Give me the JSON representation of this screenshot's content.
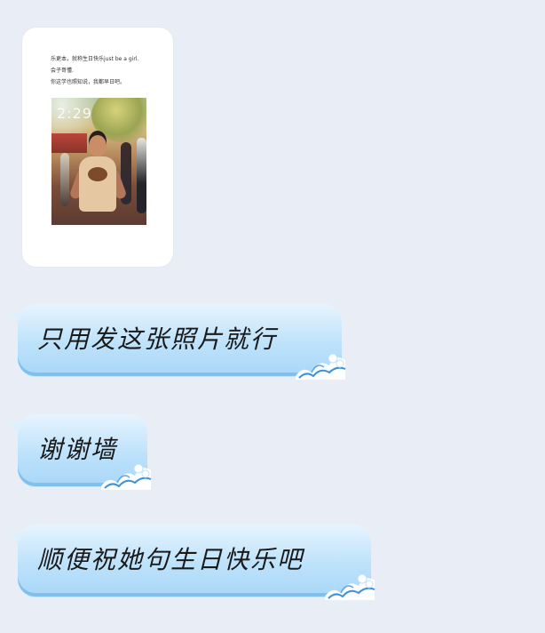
{
  "image_card": {
    "caption_lines": [
      "乐更本，就称生日快乐just be a girl.",
      "会子哥懂.",
      "你这学也照知说，我都早日吧。"
    ],
    "photo_overlay_text": "2:29"
  },
  "messages": [
    {
      "text": "只用发这张照片就行"
    },
    {
      "text": "谢谢墙"
    },
    {
      "text": "顺便祝她句生日快乐吧"
    }
  ],
  "colors": {
    "background": "#e9edf5",
    "bubble_top": "#e7f4fe",
    "bubble_bottom": "#a9d7f8",
    "bubble_edge": "#7fc0ef"
  },
  "icons": {
    "bubble_decoration": "wave-icon"
  }
}
